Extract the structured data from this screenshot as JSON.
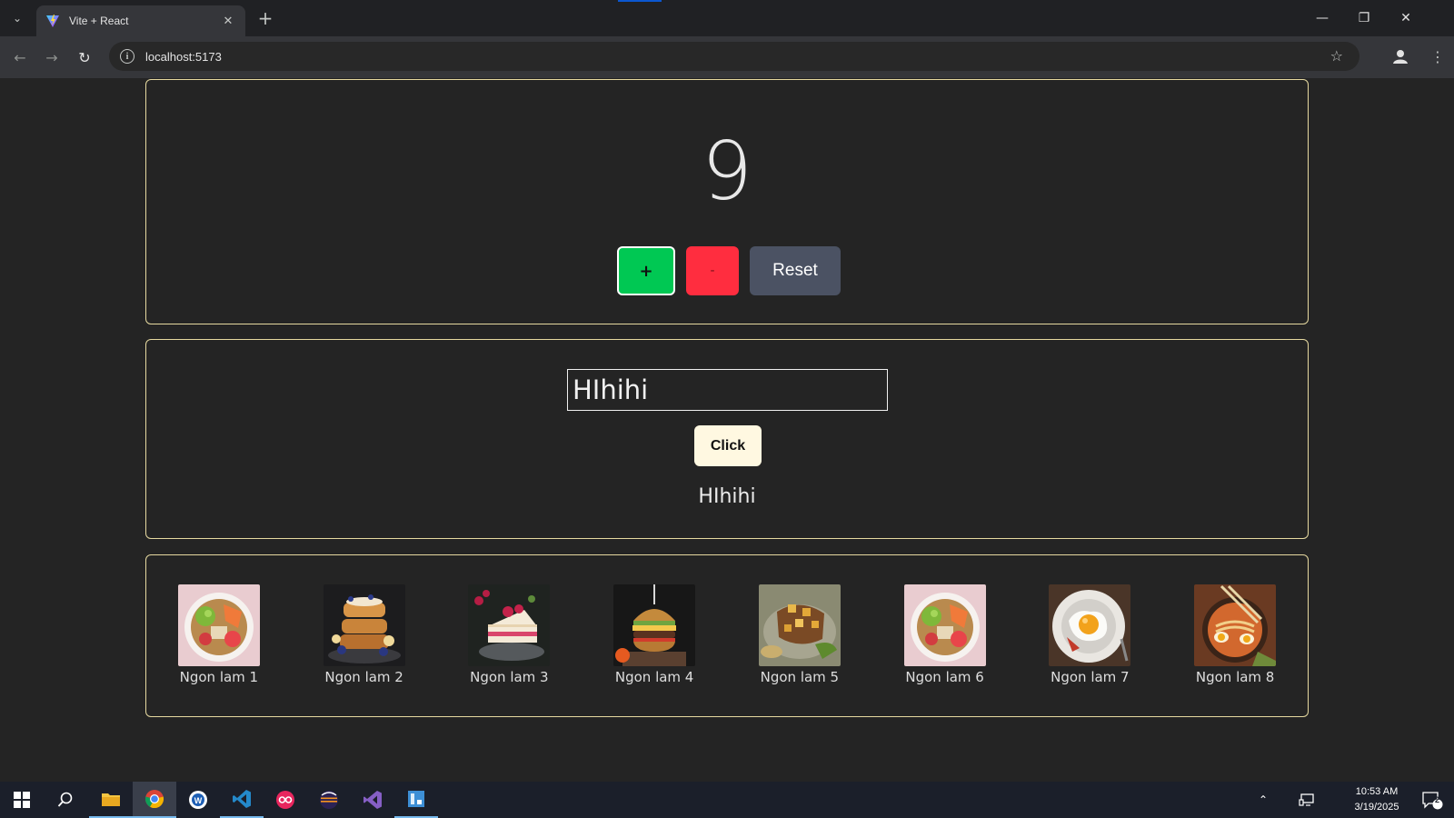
{
  "browser": {
    "tab_title": "Vite + React",
    "url": "localhost:5173"
  },
  "counter": {
    "value": "9",
    "plus_label": "+",
    "minus_label": "-",
    "reset_label": "Reset"
  },
  "echo_form": {
    "input_value": "HIhihi",
    "click_label": "Click",
    "output_text": "HIhihi"
  },
  "gallery": {
    "items": [
      {
        "label": "Ngon lam 1",
        "icon": "poke-bowl"
      },
      {
        "label": "Ngon lam 2",
        "icon": "french-toast-stack"
      },
      {
        "label": "Ngon lam 3",
        "icon": "raspberry-cake"
      },
      {
        "label": "Ngon lam 4",
        "icon": "burger"
      },
      {
        "label": "Ngon lam 5",
        "icon": "glazed-meat"
      },
      {
        "label": "Ngon lam 6",
        "icon": "poke-bowl"
      },
      {
        "label": "Ngon lam 7",
        "icon": "fried-egg-plate"
      },
      {
        "label": "Ngon lam 8",
        "icon": "ramen-bowl"
      }
    ]
  },
  "taskbar": {
    "time": "10:53 AM",
    "date": "3/19/2025",
    "notification_count": "2"
  },
  "colors": {
    "page_bg": "#242424",
    "card_border": "#e6d9a0",
    "plus_green": "#00c853",
    "minus_red": "#ff2d3f",
    "reset_gray": "#4b5263",
    "click_cream": "#fff8e1"
  }
}
